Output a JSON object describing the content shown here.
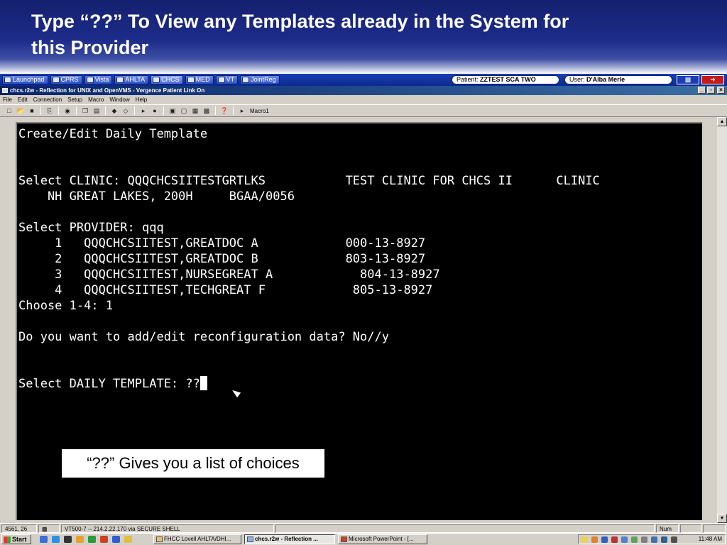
{
  "slide": {
    "title_line1": "Type “??” To View any Templates already in the System for",
    "title_line2": "this Provider"
  },
  "launch_bar": {
    "buttons": [
      "Launchpad",
      "CPRS",
      "Vista",
      "AHLTA",
      "CHCS",
      "MED",
      "VT",
      "JointReg"
    ],
    "patient_label": "Patient:",
    "patient_value": "ZZTEST SCA TWO",
    "user_label": "User:",
    "user_value": "D'Alba Merle"
  },
  "window": {
    "title": "chcs.r2w - Reflection for UNIX and OpenVMS - Vergence Patient Link On",
    "minimize": "_",
    "maximize": "▫",
    "close": "×"
  },
  "menu": [
    "File",
    "Edit",
    "Connection",
    "Setup",
    "Macro",
    "Window",
    "Help"
  ],
  "toolbar": {
    "macro_label": "Macro1"
  },
  "terminal": {
    "lines": [
      "Create/Edit Daily Template",
      "",
      "",
      "Select CLINIC: QQQCHCSIITESTGRTLKS           TEST CLINIC FOR CHCS II      CLINIC",
      "    NH GREAT LAKES, 200H     BGAA/0056",
      "",
      "Select PROVIDER: qqq",
      "     1   QQQCHCSIITEST,GREATDOC A            000-13-8927",
      "     2   QQQCHCSIITEST,GREATDOC B            803-13-8927",
      "     3   QQQCHCSIITEST,NURSEGREAT A            804-13-8927",
      "     4   QQQCHCSIITEST,TECHGREAT F            805-13-8927",
      "Choose 1-4: 1",
      "",
      "Do you want to add/edit reconfiguration data? No//y",
      "",
      ""
    ],
    "prompt": "Select DAILY TEMPLATE: ??"
  },
  "callout": {
    "text": "“??” Gives you a list of choices"
  },
  "status_bar": {
    "position": "4561, 26",
    "connection": "VT500-7 -- 214.2.22.170 via SECURE SHELL",
    "num": "Num"
  },
  "taskbar": {
    "start": "Start",
    "tasks": [
      "FHCC Lovell AHLTA/DHI...",
      "chcs.r2w - Reflection ...",
      "Microsoft PowerPoint - [..."
    ],
    "clock": "11:48 AM"
  },
  "colors": {
    "terminal_bg": "#000000",
    "terminal_fg": "#ffffff",
    "header_blue": "#1d2c8a",
    "launch_bar": "#0b2a8e"
  }
}
